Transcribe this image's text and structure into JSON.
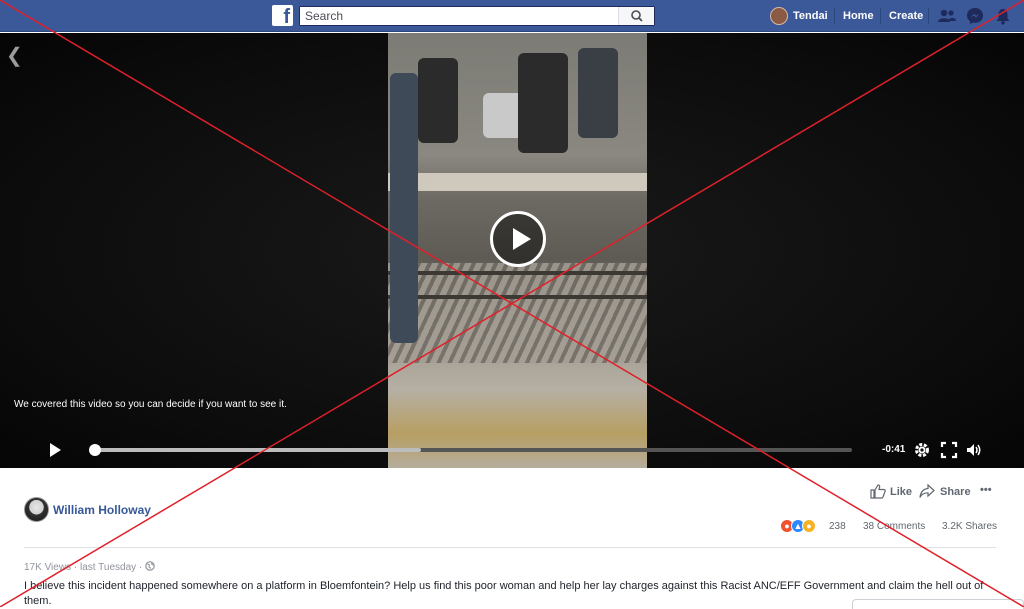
{
  "header": {
    "brand_letter": "f",
    "search_placeholder": "Search",
    "user_name": "Tendai",
    "home_label": "Home",
    "create_label": "Create",
    "icons": [
      "friends-icon",
      "messenger-icon",
      "notifications-icon",
      "search-icon"
    ]
  },
  "video": {
    "covered_notice": "We covered this video so you can decide if you want to see it.",
    "time_remaining": "-0:41",
    "progress": 0.0,
    "buffered": 0.43
  },
  "post": {
    "author": "William Holloway",
    "like_label": "Like",
    "share_label": "Share",
    "more_label": "•••",
    "reaction_count": "238",
    "comments": "38 Comments",
    "shares": "3.2K Shares",
    "views": "17K Views",
    "dot": "·",
    "time": "last Tuesday",
    "text": "I believe this incident happened somewhere on a platform in Bloemfontein? Help us find this poor woman and help her lay charges against this Racist ANC/EFF Government and claim the hell out of them."
  },
  "colors": {
    "brand": "#3b5998",
    "link": "#365899",
    "overlay_cross": "#e0202a"
  }
}
